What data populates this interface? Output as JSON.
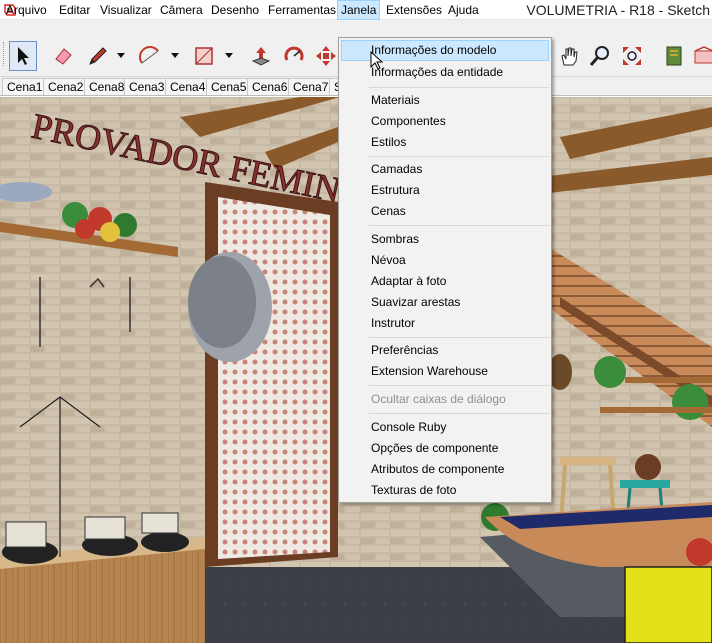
{
  "window": {
    "title": "VOLUMETRIA - R18 - Sketch"
  },
  "menubar": {
    "items": [
      {
        "label": "Arquivo"
      },
      {
        "label": "Editar"
      },
      {
        "label": "Visualizar"
      },
      {
        "label": "Câmera"
      },
      {
        "label": "Desenho"
      },
      {
        "label": "Ferramentas"
      },
      {
        "label": "Janela"
      },
      {
        "label": "Extensões"
      },
      {
        "label": "Ajuda"
      }
    ]
  },
  "toolbar": {
    "tools": [
      {
        "icon": "select-arrow-icon"
      },
      {
        "icon": "eraser-icon"
      },
      {
        "icon": "pencil-icon"
      },
      {
        "icon": "arc-icon"
      },
      {
        "icon": "rectangle-icon"
      },
      {
        "icon": "push-pull-icon"
      },
      {
        "icon": "rotate-icon"
      },
      {
        "icon": "move-icon"
      },
      {
        "icon": "pan-hand-icon"
      },
      {
        "icon": "zoom-icon"
      },
      {
        "icon": "zoom-extents-icon"
      },
      {
        "icon": "book-icon"
      },
      {
        "icon": "warehouse-icon"
      }
    ]
  },
  "scenes": {
    "tabs": [
      "Cena1",
      "Cena2",
      "Cena8",
      "Cena3",
      "Cena4",
      "Cena5",
      "Cena6",
      "Cena7",
      "S"
    ]
  },
  "viewport": {
    "sign_text": "PROVADOR FEMIN"
  },
  "janela_menu": {
    "items": [
      {
        "label": "Informações do modelo",
        "state": "hover"
      },
      {
        "label": "Informações da entidade"
      },
      {
        "label": "Materiais"
      },
      {
        "label": "Componentes"
      },
      {
        "label": "Estilos"
      },
      {
        "label": "Camadas"
      },
      {
        "label": "Estrutura"
      },
      {
        "label": "Cenas"
      },
      {
        "label": "Sombras"
      },
      {
        "label": "Névoa"
      },
      {
        "label": "Adaptar à foto"
      },
      {
        "label": "Suavizar arestas"
      },
      {
        "label": "Instrutor"
      },
      {
        "label": "Preferências"
      },
      {
        "label": "Extension Warehouse"
      },
      {
        "label": "Ocultar caixas de diálogo",
        "state": "disabled"
      },
      {
        "label": "Console Ruby"
      },
      {
        "label": "Opções de componente"
      },
      {
        "label": "Atributos de componente"
      },
      {
        "label": "Texturas de foto"
      }
    ]
  },
  "colors": {
    "menu_highlight": "#cce8ff",
    "menu_highlight_border": "#99d1ff",
    "toolbar_bg": "#f0f0f0",
    "app_icon": "#d7261d"
  }
}
